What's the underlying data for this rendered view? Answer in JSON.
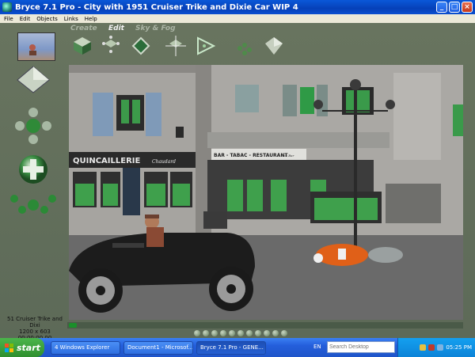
{
  "window": {
    "title": "Bryce 7.1  Pro - City with 1951 Cruiser Trike and Dixie Car WIP 4"
  },
  "menu": [
    "File",
    "Edit",
    "Objects",
    "Links",
    "Help"
  ],
  "palette_tabs": [
    "Create",
    "Edit",
    "Sky & Fog"
  ],
  "active_tab": "Edit",
  "scene_signs": {
    "shop": "QUINCAILLERIE",
    "shop_script": "Chaudard",
    "cafe": "BAR - TABAC - RESTAURANT",
    "cafe_script": "Bon Bar"
  },
  "document_info": {
    "name": "51 Cruiser Trike and Dixi",
    "size": "1200 x 603",
    "time": "00:00:00.00"
  },
  "taskbar": {
    "start": "start",
    "buttons": [
      "4 Windows Explorer",
      "Document1 - Microsof...",
      "Bryce 7.1  Pro - GENE..."
    ],
    "language": "EN",
    "search_placeholder": "Search Desktop",
    "clock": "05:25 PM"
  }
}
